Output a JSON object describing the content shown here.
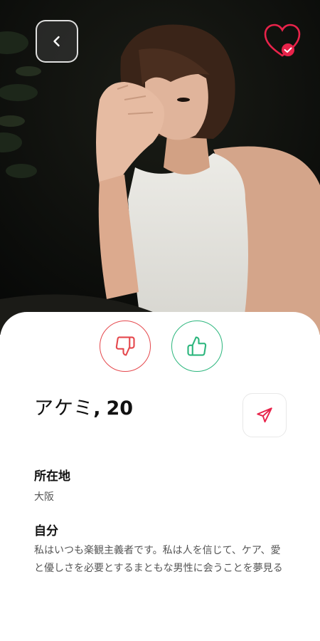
{
  "profile": {
    "name": "アケミ",
    "comma": ",",
    "age": "20"
  },
  "location": {
    "title": "所在地",
    "value": "大阪"
  },
  "about": {
    "title": "自分",
    "text": "私はいつも楽観主義者です。私は人を信じて、ケア、愛と優しさを必要とするまともな男性に会うことを夢見る"
  },
  "icons": {
    "back": "chevron-left-icon",
    "badge": "heart-check-icon",
    "dislike": "thumbs-down-icon",
    "like": "thumbs-up-icon",
    "send": "send-icon"
  },
  "colors": {
    "dislike": "#e5484d",
    "like": "#2cb67d",
    "send": "#e8234a",
    "badge": "#e8234a"
  }
}
